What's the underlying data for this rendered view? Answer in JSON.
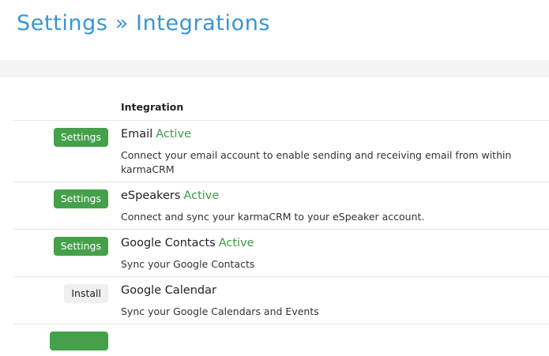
{
  "header": {
    "title": "Settings » Integrations"
  },
  "table": {
    "column_header": "Integration",
    "rows": [
      {
        "button_label": "Settings",
        "name": "Email",
        "status": "Active",
        "description": "Connect your email account to enable sending and receiving email from within karmaCRM"
      },
      {
        "button_label": "Settings",
        "name": "eSpeakers",
        "status": "Active",
        "description": "Connect and sync your karmaCRM to your eSpeaker account."
      },
      {
        "button_label": "Settings",
        "name": "Google Contacts",
        "status": "Active",
        "description": "Sync your Google Contacts"
      },
      {
        "button_label": "Install",
        "name": "Google Calendar",
        "status": "",
        "description": "Sync your Google Calendars and Events"
      }
    ]
  },
  "colors": {
    "title": "#3a95d4",
    "active_status": "#3f9a45",
    "settings_button": "#45a04a",
    "install_button": "#f0f0f0"
  }
}
